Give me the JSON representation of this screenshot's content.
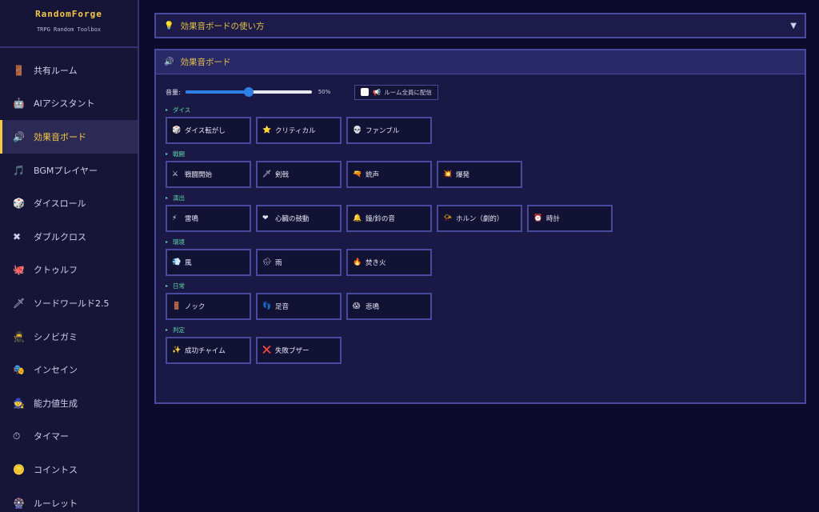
{
  "app": {
    "title": "RandomForge",
    "subtitle": "TRPG Random Toolbox"
  },
  "sidebar": {
    "items": [
      {
        "icon": "🚪",
        "icon_name": "door-icon",
        "label": "共有ルーム",
        "active": false
      },
      {
        "icon": "🤖",
        "icon_name": "robot-icon",
        "label": "AIアシスタント",
        "active": false
      },
      {
        "icon": "🔊",
        "icon_name": "speaker-icon",
        "label": "効果音ボード",
        "active": true
      },
      {
        "icon": "🎵",
        "icon_name": "music-note-icon",
        "label": "BGMプレイヤー",
        "active": false
      },
      {
        "icon": "🎲",
        "icon_name": "dice-icon",
        "label": "ダイスロール",
        "active": false
      },
      {
        "icon": "✖",
        "icon_name": "cross-icon",
        "label": "ダブルクロス",
        "active": false
      },
      {
        "icon": "🐙",
        "icon_name": "octopus-icon",
        "label": "クトゥルフ",
        "active": false
      },
      {
        "icon": "🗡",
        "icon_name": "sword-icon",
        "label": "ソードワールド2.5",
        "active": false
      },
      {
        "icon": "🥷",
        "icon_name": "ninja-icon",
        "label": "シノビガミ",
        "active": false
      },
      {
        "icon": "🎭",
        "icon_name": "masks-icon",
        "label": "インセイン",
        "active": false
      },
      {
        "icon": "🧙",
        "icon_name": "wizard-icon",
        "label": "能力値生成",
        "active": false
      },
      {
        "icon": "⏱",
        "icon_name": "stopwatch-icon",
        "label": "タイマー",
        "active": false
      },
      {
        "icon": "🪙",
        "icon_name": "coin-icon",
        "label": "コイントス",
        "active": false
      },
      {
        "icon": "🎡",
        "icon_name": "wheel-icon",
        "label": "ルーレット",
        "active": false
      }
    ]
  },
  "howto": {
    "icon": "💡",
    "label": "効果音ボードの使い方",
    "chevron": "▼"
  },
  "panel": {
    "icon": "🔊",
    "title": "効果音ボード",
    "volume_label": "音量:",
    "volume_value": "50%",
    "volume_fraction": 0.5,
    "broadcast_icon": "📢",
    "broadcast_label": "ルーム全員に配信",
    "broadcast_checked": false,
    "category_marker": "▸",
    "categories": [
      {
        "title": "ダイス",
        "buttons": [
          {
            "icon": "🎲",
            "name": "dice-icon",
            "label": "ダイス転がし"
          },
          {
            "icon": "⭐",
            "name": "star-icon",
            "label": "クリティカル"
          },
          {
            "icon": "💀",
            "name": "skull-icon",
            "label": "ファンブル"
          }
        ]
      },
      {
        "title": "戦闘",
        "buttons": [
          {
            "icon": "⚔",
            "name": "crossed-swords-icon",
            "label": "戦闘開始"
          },
          {
            "icon": "🗡",
            "name": "sword-icon",
            "label": "剣戟"
          },
          {
            "icon": "🔫",
            "name": "gun-icon",
            "label": "銃声"
          },
          {
            "icon": "💥",
            "name": "explosion-icon",
            "label": "爆発"
          }
        ]
      },
      {
        "title": "演出",
        "buttons": [
          {
            "icon": "⚡",
            "name": "lightning-icon",
            "label": "雷鳴"
          },
          {
            "icon": "❤",
            "name": "heart-icon",
            "label": "心臓の鼓動"
          },
          {
            "icon": "🔔",
            "name": "bell-icon",
            "label": "鐘/鈴の音"
          },
          {
            "icon": "📯",
            "name": "horn-icon",
            "label": "ホルン（劇的）"
          },
          {
            "icon": "⏰",
            "name": "alarm-clock-icon",
            "label": "時計"
          }
        ]
      },
      {
        "title": "環境",
        "buttons": [
          {
            "icon": "💨",
            "name": "wind-icon",
            "label": "風"
          },
          {
            "icon": "🌧",
            "name": "rain-icon",
            "label": "雨"
          },
          {
            "icon": "🔥",
            "name": "fire-icon",
            "label": "焚き火"
          }
        ]
      },
      {
        "title": "日常",
        "buttons": [
          {
            "icon": "🚪",
            "name": "door-icon",
            "label": "ノック"
          },
          {
            "icon": "👣",
            "name": "footprints-icon",
            "label": "足音"
          },
          {
            "icon": "😱",
            "name": "scream-icon",
            "label": "悲鳴"
          }
        ]
      },
      {
        "title": "判定",
        "buttons": [
          {
            "icon": "✨",
            "name": "sparkles-icon",
            "label": "成功チャイム"
          },
          {
            "icon": "❌",
            "name": "cross-mark-icon",
            "label": "失敗ブザー"
          }
        ]
      }
    ]
  }
}
